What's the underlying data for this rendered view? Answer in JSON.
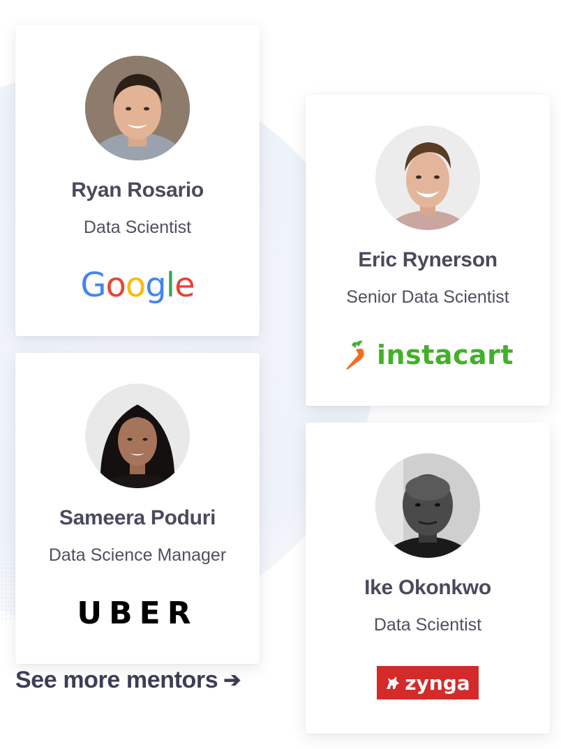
{
  "mentors": [
    {
      "id": "ryan",
      "name": "Ryan Rosario",
      "title": "Data Scientist",
      "company": "Google",
      "logo_letters": [
        "G",
        "o",
        "o",
        "g",
        "l",
        "e"
      ],
      "logo_colors": [
        "#4285F4",
        "#EA4335",
        "#FBBC05",
        "#4285F4",
        "#34A853",
        "#EA4335"
      ]
    },
    {
      "id": "sameera",
      "name": "Sameera Poduri",
      "title": "Data Science Manager",
      "company": "UBER"
    },
    {
      "id": "eric",
      "name": "Eric Rynerson",
      "title": "Senior Data Scientist",
      "company": "instacart",
      "logo_color": "#43b02a",
      "carrot_color": "#f36d21"
    },
    {
      "id": "ike",
      "name": "Ike Okonkwo",
      "title": "Data Scientist",
      "company": "zynga",
      "logo_bg": "#d42a2a"
    }
  ],
  "see_more": {
    "label": "See more mentors",
    "arrow": "➔"
  },
  "colors": {
    "name_text": "#4a4a5e",
    "title_text": "#4f4f5f",
    "link_text": "#3d3d57"
  }
}
